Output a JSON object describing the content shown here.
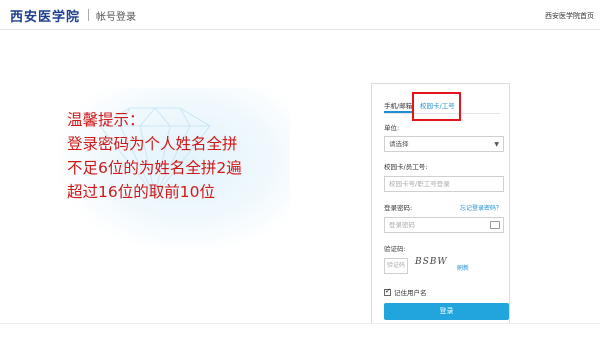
{
  "header": {
    "logo_text": "西安医学院",
    "page_name": "帐号登录",
    "home_link": "西安医学院首页"
  },
  "notice": {
    "lines": [
      "温馨提示：",
      "登录密码为个人姓名全拼",
      "不足6位的为姓名全拼2遍",
      "超过16位的取前10位"
    ],
    "color": "#d01818"
  },
  "login": {
    "tabs": [
      {
        "label": "手机/邮箱",
        "active": false
      },
      {
        "label": "校园卡/工号",
        "active": true
      }
    ],
    "unit_label": "单位:",
    "unit_value": "请选择",
    "account_label": "校园卡/员工号:",
    "account_placeholder": "校园卡号/职工号登录",
    "password_label": "登录密码:",
    "forgot_label": "忘记登录密码？",
    "password_placeholder": "登录密码",
    "captcha_label": "验证码:",
    "captcha_placeholder": "验证码",
    "captcha_text": "BSBW",
    "refresh_label": "刷新",
    "remember_label": "记住用户名",
    "remember_checked": true,
    "submit_label": "登录"
  },
  "colors": {
    "accent": "#1e8fd0",
    "button": "#22a4dc",
    "highlight": "#e3141b",
    "logo": "#1d3f8f"
  },
  "icons": [
    "arrow-left-icon",
    "keyboard-icon",
    "chevron-down-icon",
    "checkbox-icon",
    "diamond-graphic"
  ]
}
